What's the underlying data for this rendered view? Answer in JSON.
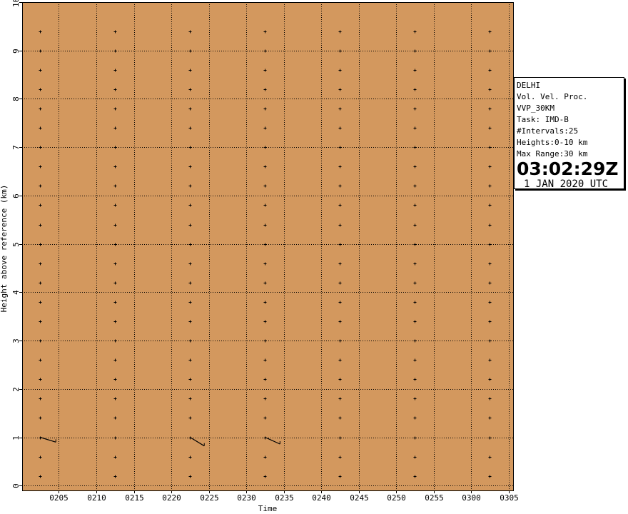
{
  "chart_data": {
    "type": "scatter",
    "title": "",
    "xlabel": "Time",
    "ylabel": "Height above reference (km)",
    "x_ticks": [
      "0205",
      "0210",
      "0215",
      "0220",
      "0225",
      "0230",
      "0235",
      "0240",
      "0245",
      "0250",
      "0255",
      "0300",
      "0305"
    ],
    "x_tick_minutes": [
      125,
      130,
      135,
      140,
      145,
      150,
      155,
      160,
      165,
      170,
      175,
      180,
      185
    ],
    "xlim_minutes": [
      120.1,
      185.6
    ],
    "y_ticks": [
      0,
      1,
      2,
      3,
      4,
      5,
      6,
      7,
      8,
      9,
      10
    ],
    "ylim": [
      -0.1,
      10.0
    ],
    "grid": true,
    "background_color": "#D3985E",
    "grid_color": "#000000",
    "profile_times_minutes": [
      122.5,
      132.5,
      142.5,
      152.5,
      162.5,
      172.5,
      182.5
    ],
    "profile_times_labels": [
      "0202:30",
      "0212:30",
      "0222:30",
      "0232:30",
      "0242:30",
      "0252:30",
      "0302:30"
    ],
    "heights_km": [
      0.2,
      0.6,
      1.0,
      1.4,
      1.8,
      2.2,
      2.6,
      3.0,
      3.4,
      3.8,
      4.2,
      4.6,
      5.0,
      5.4,
      5.8,
      6.2,
      6.6,
      7.0,
      7.4,
      7.8,
      8.2,
      8.6,
      9.0,
      9.4
    ],
    "wind_barbs": [
      {
        "time_minutes": 122.5,
        "height_km": 1.0,
        "dx_minutes": 2.1,
        "dy_km": -0.1
      },
      {
        "time_minutes": 142.5,
        "height_km": 1.0,
        "dx_minutes": 1.9,
        "dy_km": -0.18
      },
      {
        "time_minutes": 152.5,
        "height_km": 1.0,
        "dx_minutes": 2.0,
        "dy_km": -0.14
      }
    ]
  },
  "info_box": {
    "station": "DELHI",
    "product": "Vol. Vel. Proc.",
    "product_code": "VVP_30KM",
    "task": "Task: IMD-B",
    "intervals": "#Intervals:25",
    "heights": "Heights:0-10 km",
    "max_range": "Max Range:30 km",
    "time": "03:02:29Z",
    "date": "1 JAN 2020 UTC"
  }
}
